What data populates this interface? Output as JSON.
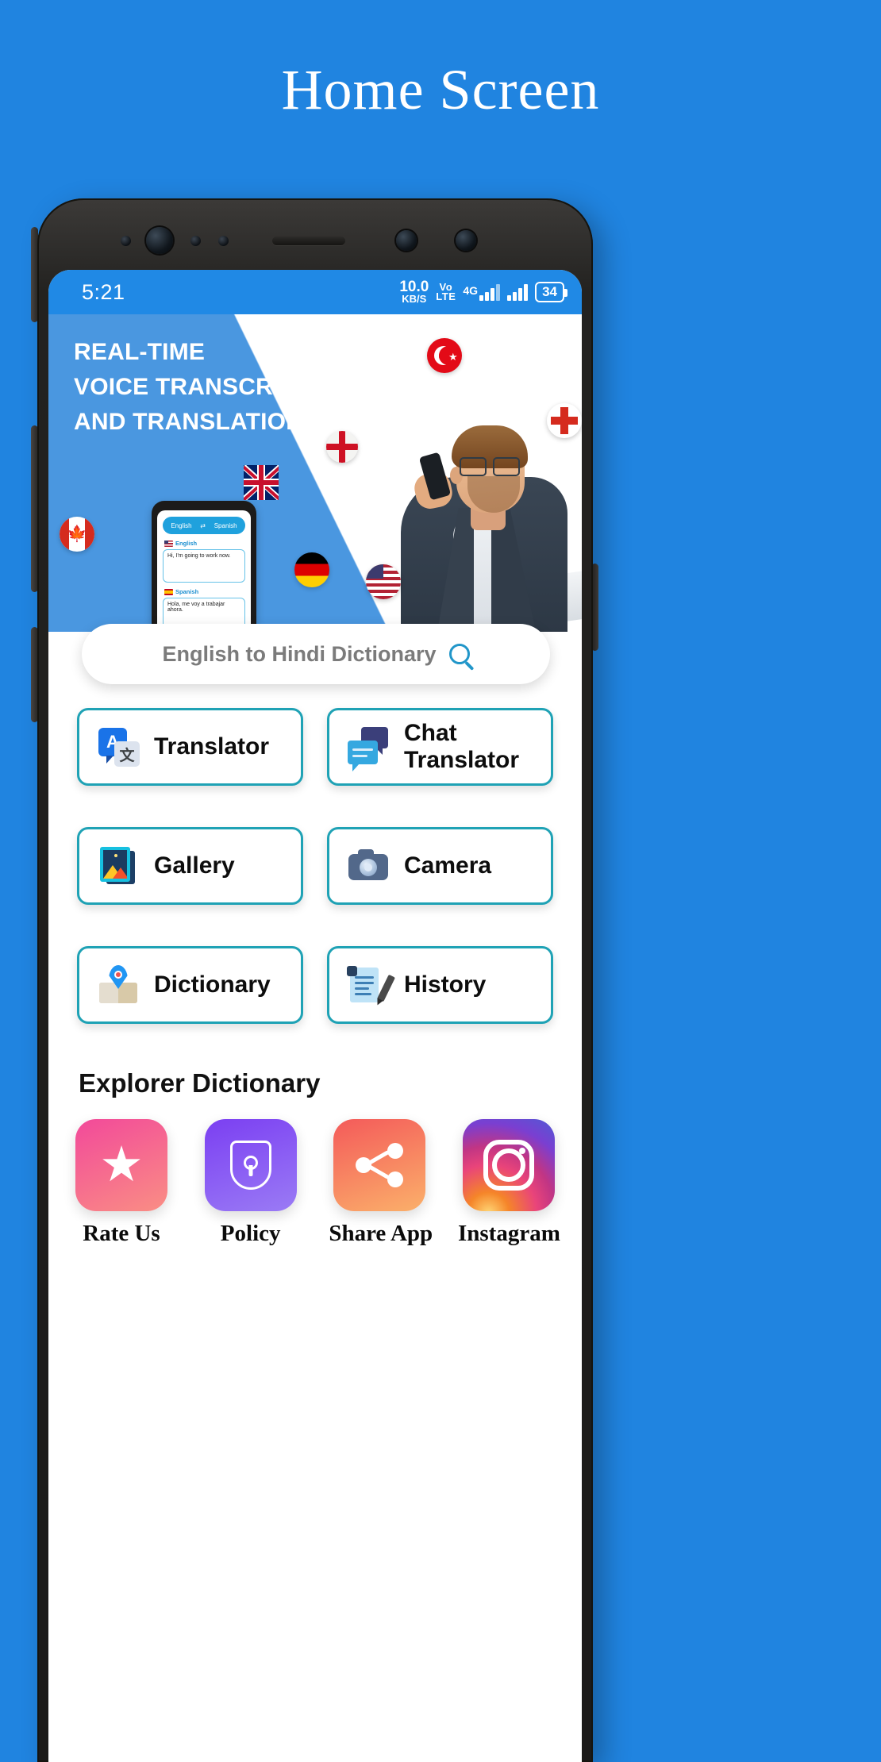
{
  "page": {
    "title": "Home Screen",
    "background_color": "#2084e0"
  },
  "statusbar": {
    "time": "5:21",
    "data_rate_value": "10.0",
    "data_rate_unit": "KB/S",
    "volte_line1": "Vo",
    "volte_line2": "LTE",
    "network": "4G",
    "battery": "34"
  },
  "hero": {
    "line1": "REAL-TIME",
    "line2": "VOICE TRANSCRIPTION",
    "line3": "AND TRANSLATION",
    "mini_phone": {
      "source_pill": "English",
      "target_pill": "Spanish",
      "swap_icon": "swap-icon",
      "source_label": "English",
      "source_text": "Hi, I'm going to work now.",
      "target_label": "Spanish",
      "target_text": "Hola, me voy a trabajar ahora.",
      "mic_icon": "microphone-icon"
    },
    "flags": [
      "turkey",
      "switzerland",
      "england",
      "united-kingdom",
      "canada",
      "germany",
      "united-states"
    ]
  },
  "search": {
    "text": "English to Hindi Dictionary",
    "icon": "search-icon"
  },
  "features": [
    {
      "label": "Translator",
      "icon": "translator-icon"
    },
    {
      "label": "Chat Translator",
      "icon": "chat-translator-icon"
    },
    {
      "label": "Gallery",
      "icon": "gallery-icon"
    },
    {
      "label": "Camera",
      "icon": "camera-icon"
    },
    {
      "label": "Dictionary",
      "icon": "dictionary-icon"
    },
    {
      "label": "History",
      "icon": "history-icon"
    }
  ],
  "explorer": {
    "title": "Explorer Dictionary",
    "items": [
      {
        "label": "Rate Us",
        "icon": "star-icon"
      },
      {
        "label": "Policy",
        "icon": "shield-lock-icon"
      },
      {
        "label": "Share App",
        "icon": "share-icon"
      },
      {
        "label": "Instagram",
        "icon": "instagram-icon"
      }
    ]
  },
  "colors": {
    "brand_blue": "#2084e0",
    "status_blue": "#2089e5",
    "hero_blue": "#4a97e0",
    "tile_border_teal": "#1fa2b5",
    "search_text_gray": "#7b7b7b"
  }
}
